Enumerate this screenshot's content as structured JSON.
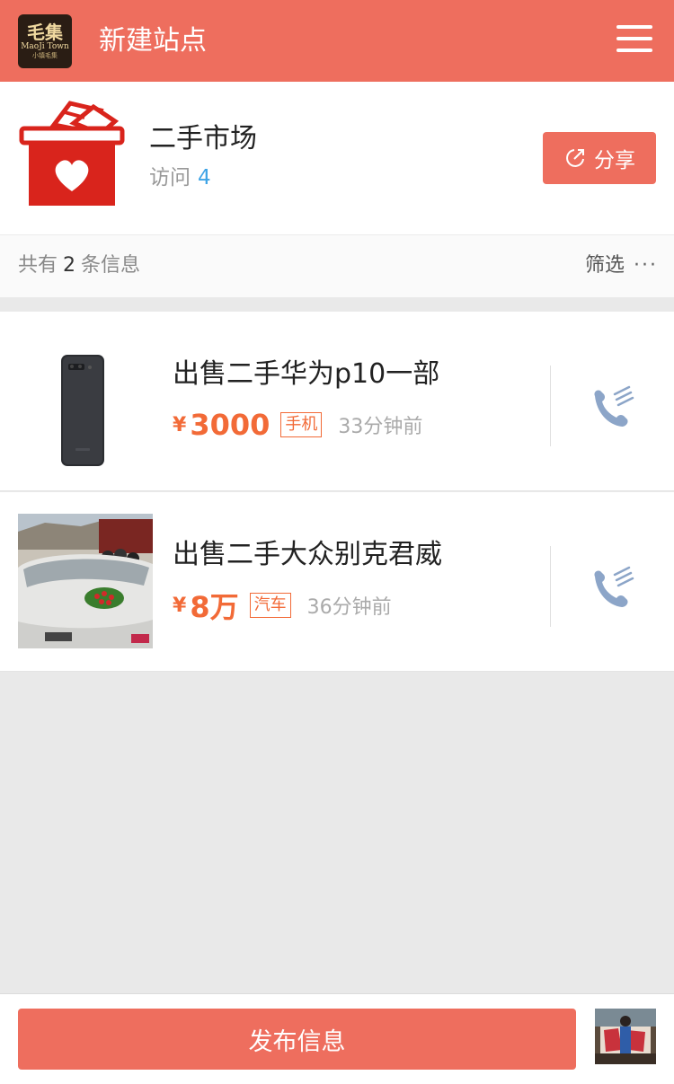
{
  "header": {
    "site_title": "新建站点",
    "logo": {
      "line1": "毛集",
      "line2": "MaoJi Town",
      "line3": "小镇毛集"
    }
  },
  "category": {
    "title": "二手市场",
    "visits_label": "访问",
    "visits_count": "4",
    "share_label": "分享"
  },
  "filterbar": {
    "count_prefix": "共有",
    "count": "2",
    "count_suffix": "条信息",
    "filter_label": "筛选",
    "more": "···"
  },
  "listings": [
    {
      "title": "出售二手华为p10一部",
      "currency": "¥",
      "price": "3000",
      "tag": "手机",
      "time": "33分钟前",
      "icon": "phone-icon"
    },
    {
      "title": "出售二手大众别克君威",
      "currency": "¥",
      "price": "8万",
      "tag": "汽车",
      "time": "36分钟前",
      "icon": "car-photo"
    }
  ],
  "footer": {
    "publish_label": "发布信息"
  },
  "colors": {
    "brand": "#ee6e5e",
    "price": "#f26a37",
    "visits": "#3fa4e6",
    "phone_icon": "#8ca5c8"
  }
}
